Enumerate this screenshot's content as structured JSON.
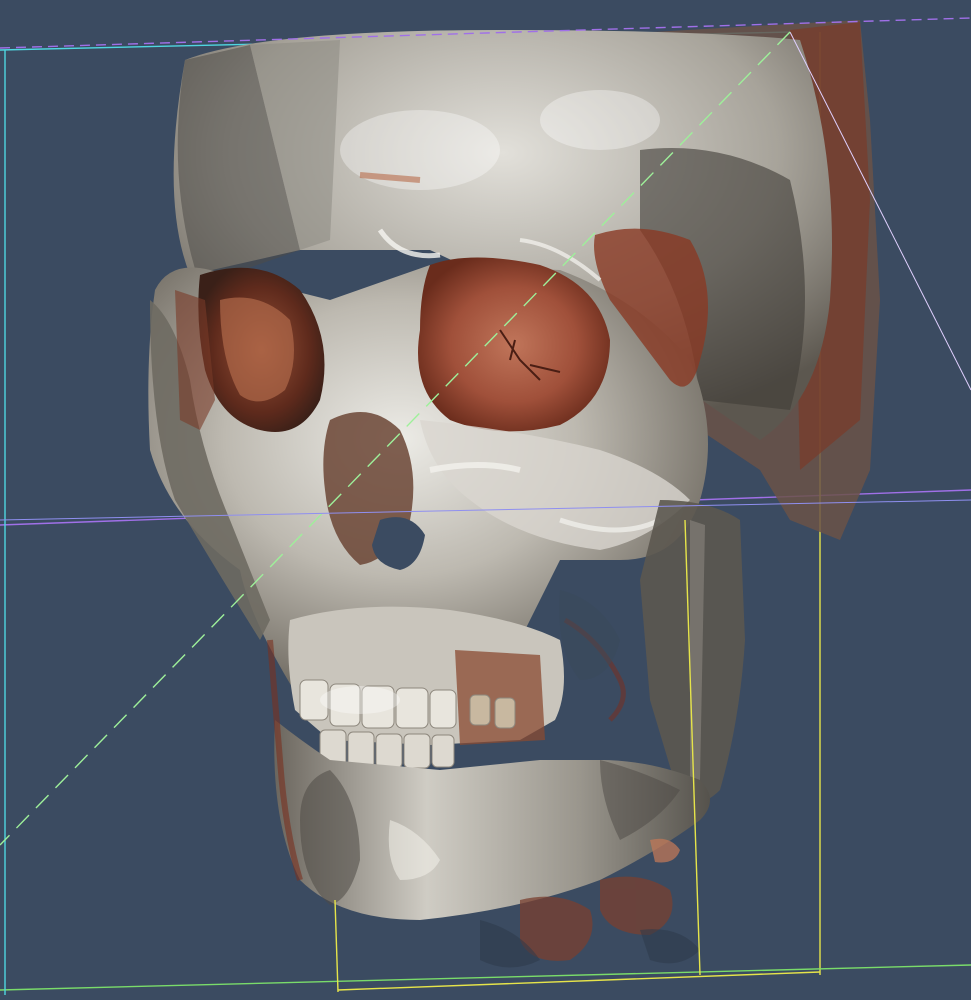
{
  "viewer": {
    "render_mode": "volume-rendering",
    "subject": "skull",
    "background_color": "#3b4b61"
  },
  "colors": {
    "bone": "#b8b4aa",
    "bone_highlight": "#e8e6e0",
    "bone_shadow": "#5a5854",
    "tissue_red": "#8a3a22",
    "tissue_orange": "#b8603a",
    "clip_box_yellow": "#e6e44a",
    "clip_box_cyan": "#4fd6e0",
    "clip_box_purple": "#a070e8",
    "clip_box_green": "#7adc6a"
  },
  "icons": {
    "volume": "skull-volume-icon"
  }
}
